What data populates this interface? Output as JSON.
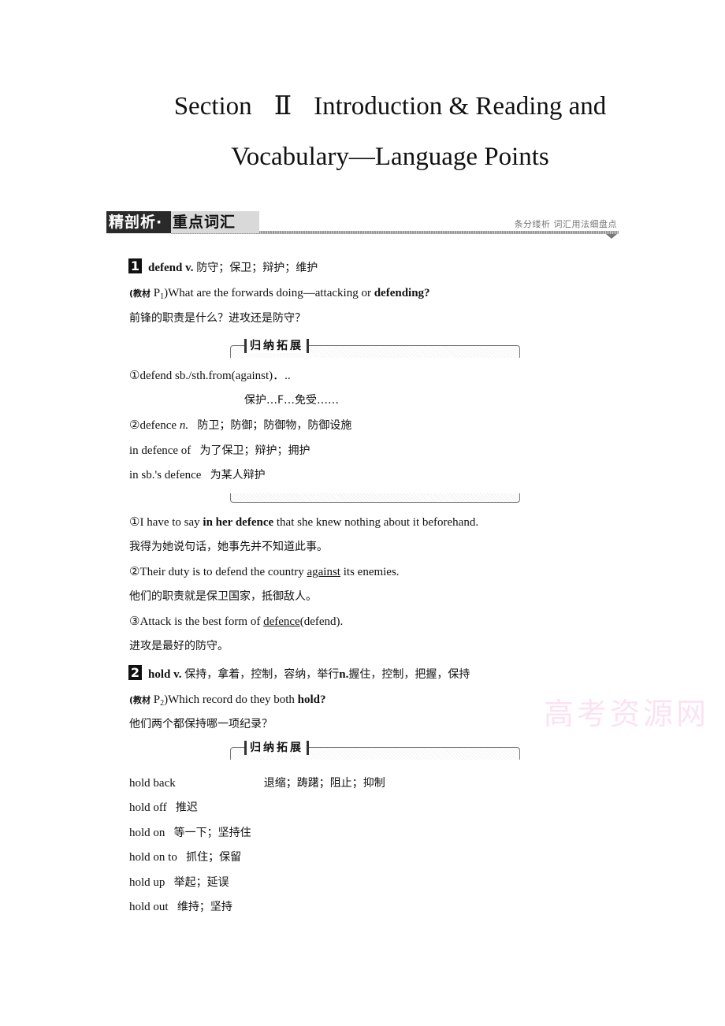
{
  "title": {
    "line1_section": "Section",
    "line1_roman": "Ⅱ",
    "line1_rest": "Introduction & Reading and",
    "line2": "Vocabulary—Language Points"
  },
  "banner": {
    "dark_label": "精剖析",
    "dot": "·",
    "light_label": "重点词汇",
    "right_text": "条分缕析  词汇用法细盘点"
  },
  "entries": [
    {
      "number": "1",
      "headword": "defend v.",
      "meaning": "防守；保卫；辩护；维护",
      "source_label": "(教材",
      "source_page": "P",
      "source_sub": "1",
      "source_close": ")",
      "example_pre": "What are the forwards doing—attacking or ",
      "example_bold": "defending?",
      "example_zh": "前锋的职责是什么？进攻还是防守？",
      "box_label": "归纳拓展",
      "box_lines": [
        {
          "en": "①defend sb./sth.from(against)．..",
          "zh": ""
        },
        {
          "en": "",
          "zh": "保护…F…免受……"
        },
        {
          "en": "②defence ",
          "pos": "n.",
          "zh": "防卫；防御；防御物，防御设施"
        },
        {
          "en": "in defence of",
          "zh": "为了保卫；辩护；拥护"
        },
        {
          "en": "in sb.'s defence",
          "zh": "为某人辩护"
        }
      ],
      "examples": [
        {
          "pre": "①I have to say ",
          "bold": "in her defence",
          "post": " that she knew nothing about it beforehand.",
          "zh": "我得为她说句话，她事先并不知道此事。"
        },
        {
          "pre": "②Their duty is to defend the country ",
          "underline": "against",
          "post": " its enemies.",
          "zh": "他们的职责就是保卫国家，抵御敌人。"
        },
        {
          "pre": "③Attack is the best form of ",
          "underline": "defence",
          "post": "(defend).",
          "zh": "进攻是最好的防守。"
        }
      ]
    },
    {
      "number": "2",
      "headword": "hold v.",
      "meaning": "保持，拿着，控制，容纳，举行",
      "noun_label": "n.",
      "noun_meaning": "握住，控制，把握，保持",
      "source_label": "(教材",
      "source_page": "P",
      "source_sub": "2",
      "source_close": ")",
      "example_pre": "Which record do they both ",
      "example_bold": "hold?",
      "example_zh": "他们两个都保持哪一项纪录？",
      "box_label": "归纳拓展",
      "phrases": [
        {
          "en": "hold back",
          "zh": "退缩；踌躇；阻止；抑制"
        },
        {
          "en": "hold off",
          "zh": "推迟"
        },
        {
          "en": "hold on",
          "zh": "等一下；坚持住"
        },
        {
          "en": "hold on to",
          "zh": "抓住；保留"
        },
        {
          "en": "hold up",
          "zh": "举起；延误"
        },
        {
          "en": "hold out",
          "zh": "维持；坚持"
        }
      ]
    }
  ],
  "watermark": "高考资源网"
}
